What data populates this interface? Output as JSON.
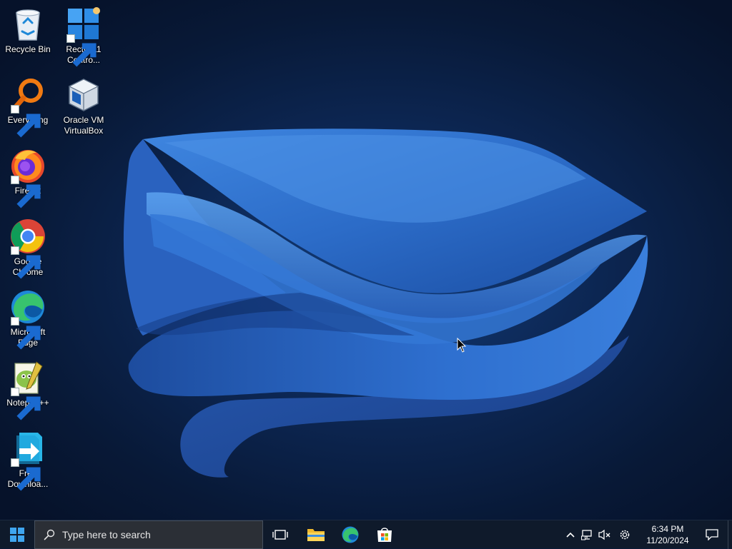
{
  "desktop": {
    "icons": [
      {
        "label": "Recycle Bin",
        "icon": "recycle-bin-icon",
        "shortcut": false
      },
      {
        "label": "Rectify11 Contro...",
        "icon": "control-panel-icon",
        "shortcut": true
      },
      {
        "label": "Everything",
        "icon": "everything-search-icon",
        "shortcut": true
      },
      {
        "label": "Oracle VM VirtualBox",
        "icon": "virtualbox-icon",
        "shortcut": false
      },
      {
        "label": "Firefox",
        "icon": "firefox-icon",
        "shortcut": true
      },
      {
        "label": "Google Chrome",
        "icon": "chrome-icon",
        "shortcut": true
      },
      {
        "label": "Microsoft Edge",
        "icon": "edge-icon",
        "shortcut": true
      },
      {
        "label": "Notepad++",
        "icon": "notepad-plus-plus-icon",
        "shortcut": true
      },
      {
        "label": "Free Downloa...",
        "icon": "free-download-manager-icon",
        "shortcut": true
      }
    ]
  },
  "taskbar": {
    "search_placeholder": "Type here to search",
    "pinned": [
      "task-view-icon",
      "file-explorer-icon",
      "edge-icon",
      "microsoft-store-icon"
    ],
    "tray": [
      "chevron-up-icon",
      "network-icon",
      "volume-muted-icon",
      "settings-gear-icon"
    ],
    "clock": {
      "time": "6:34 PM",
      "date": "11/20/2024"
    }
  },
  "colors": {
    "desktop_bg": "#0b1a38",
    "bloom": "#2f6fd0",
    "taskbar": "#0f1a2b",
    "search_box": "#2b2f36"
  }
}
